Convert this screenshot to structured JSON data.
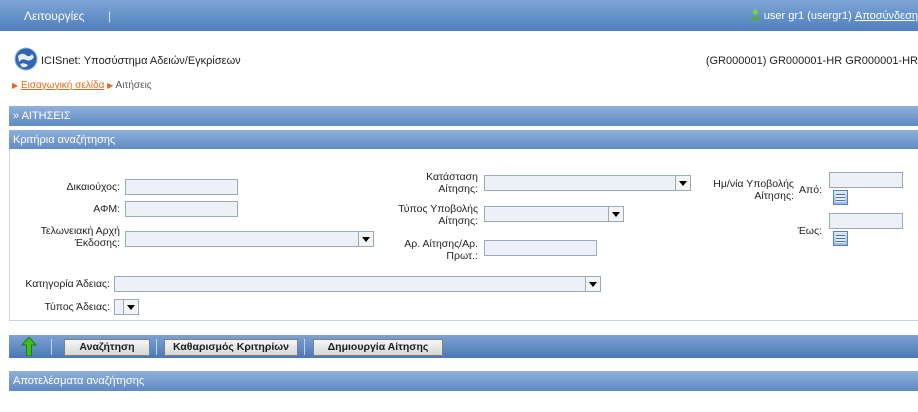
{
  "topbar": {
    "menu_label": "Λειτουργίες",
    "separator": "|",
    "user_text": "user gr1 (usergr1)",
    "logout_label": "Αποσύνδεση"
  },
  "header": {
    "app_title": "ICISnet: Υποσύστημα Αδειών/Εγκρίσεων",
    "org_text": "(GR000001) GR000001-HR GR000001-HR"
  },
  "breadcrumb": {
    "home_link": "Εισαγωγική σελίδα",
    "current": "Αιτήσεις"
  },
  "page_section": {
    "title": "» ΑΙΤΗΣΕΙΣ"
  },
  "criteria": {
    "title": "Κριτήρια αναζήτησης",
    "beneficiary_label": "Δικαιούχος:",
    "afm_label": "ΑΦΜ:",
    "customs_label_1": "Τελωνειακή Αρχή",
    "customs_label_2": "Έκδοσης:",
    "status_label_1": "Κατάσταση",
    "status_label_2": "Αίτησης:",
    "submission_type_label_1": "Τύπος Υποβολής",
    "submission_type_label_2": "Αίτησης:",
    "application_no_label_1": "Αρ. Αίτησης/Αρ.",
    "application_no_label_2": "Πρωτ.:",
    "date_label_1": "Ημ/νία Υποβολής",
    "date_label_2": "Αίτησης:",
    "from_label": "Από:",
    "to_label": "Έως:",
    "category_label": "Κατηγορία Άδειας:",
    "license_type_label": "Τύπος Άδειας:"
  },
  "toolbar": {
    "search_label": "Αναζήτηση",
    "clear_label": "Καθαρισμός Κριτηρίων",
    "create_label": "Δημιουργία Αίτησης"
  },
  "results": {
    "title": "Αποτελέσματα αναζήτησης"
  }
}
